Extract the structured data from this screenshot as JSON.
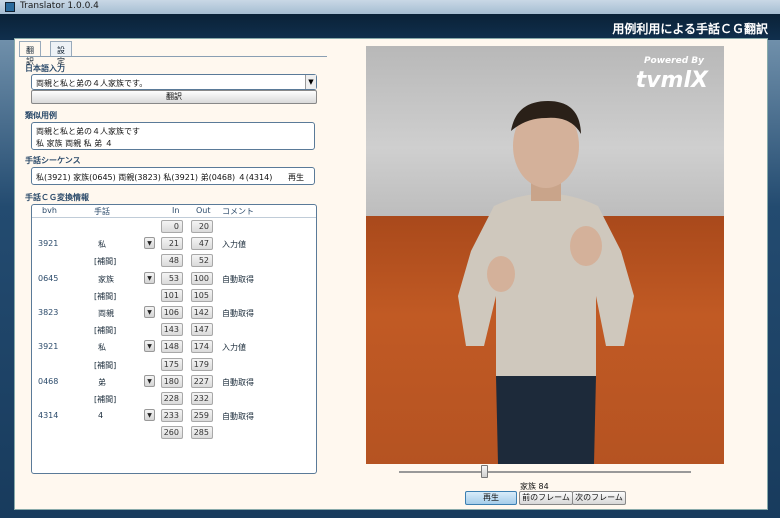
{
  "window": {
    "title": "Translator 1.0.0.4"
  },
  "banner": {
    "title": "用例利用による手話ＣＧ翻訳"
  },
  "tabs": [
    {
      "label": "翻訳"
    },
    {
      "label": "設定"
    }
  ],
  "input": {
    "label": "日本語入力",
    "value": "両親と私と弟の４人家族です。",
    "translate_label": "翻訳"
  },
  "similar": {
    "label": "類似用例",
    "line1": "両親と私と弟の４人家族です",
    "line2": "私 家族 両親 私 弟 ４"
  },
  "sequence": {
    "label": "手話シーケンス",
    "value": "私(3921) 家族(0645) 両親(3823) 私(3921) 弟(0468) ４(4314)",
    "play_label": "再生"
  },
  "grid": {
    "label": "手話ＣＧ変換情報",
    "headers": {
      "bvh": "bvh",
      "word": "手話",
      "in": "In",
      "out": "Out",
      "comment": "コメント"
    },
    "rows": [
      {
        "bvh": "",
        "word": "",
        "in": "0",
        "out": "20",
        "comment": ""
      },
      {
        "bvh": "3921",
        "word": "私",
        "in": "21",
        "out": "47",
        "comment": "入力値"
      },
      {
        "bvh": "",
        "word": "[補間]",
        "in": "48",
        "out": "52",
        "comment": ""
      },
      {
        "bvh": "0645",
        "word": "家族",
        "in": "53",
        "out": "100",
        "comment": "自動取得"
      },
      {
        "bvh": "",
        "word": "[補間]",
        "in": "101",
        "out": "105",
        "comment": ""
      },
      {
        "bvh": "3823",
        "word": "両親",
        "in": "106",
        "out": "142",
        "comment": "自動取得"
      },
      {
        "bvh": "",
        "word": "[補間]",
        "in": "143",
        "out": "147",
        "comment": ""
      },
      {
        "bvh": "3921",
        "word": "私",
        "in": "148",
        "out": "174",
        "comment": "入力値"
      },
      {
        "bvh": "",
        "word": "[補間]",
        "in": "175",
        "out": "179",
        "comment": ""
      },
      {
        "bvh": "0468",
        "word": "弟",
        "in": "180",
        "out": "227",
        "comment": "自動取得"
      },
      {
        "bvh": "",
        "word": "[補間]",
        "in": "228",
        "out": "232",
        "comment": ""
      },
      {
        "bvh": "4314",
        "word": "4",
        "in": "233",
        "out": "259",
        "comment": "自動取得"
      },
      {
        "bvh": "",
        "word": "",
        "in": "260",
        "out": "285",
        "comment": ""
      }
    ]
  },
  "viewer": {
    "powered": "Powered By",
    "brand": "tvmlX"
  },
  "playback": {
    "frame_label": "家族 84",
    "play_label": "再生",
    "prev_label": "前のフレーム",
    "next_label": "次のフレーム",
    "position": 0.29
  }
}
